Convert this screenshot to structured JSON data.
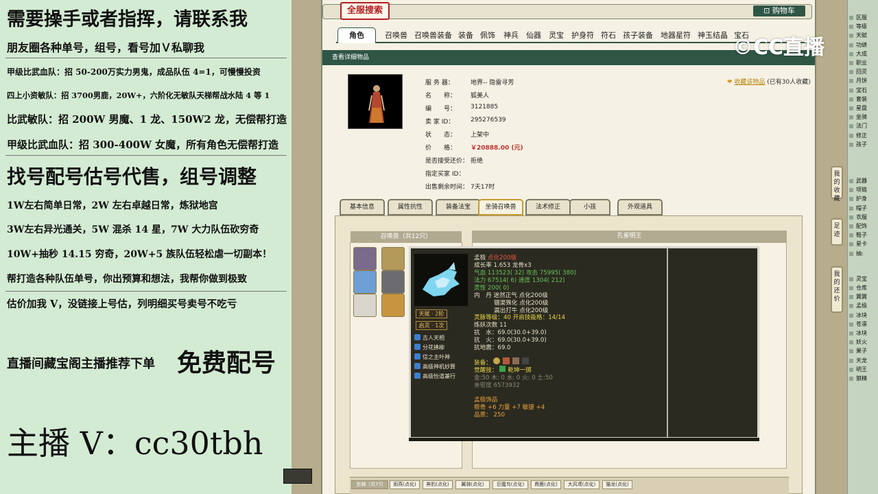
{
  "overlay": {
    "lines": [
      "需要操手或者指挥，请联系我",
      "朋友圈各种单号，组号，看号加Ｖ私聊我",
      "甲级比武血队：招 50-200万实力男鬼，成品队伍 4=1，可慢慢投资",
      "四上小资敏队：招 3700男鹿，20W+，六阶化无敏队天梯帮战水陆 4 等 1",
      "比武敏队：招 200W 男魔、1 龙、150W2 龙，无偿帮打造",
      "甲级比武血队：招 300-400W 女魔，所有角色无偿帮打造",
      "找号配号估号代售，组号调整",
      "1W左右简单日常，2W 左右卓越日常，炼狱地宫",
      "3W左右异光通关，5W 混杀 14 星，7W 大力队伍砍穷奇",
      "10W+抽秒 14.15 穷奇，20W+5 族队伍轻松虐一切副本！",
      "帮打造各种队伍单号，你出预算和想法，我帮你做到极致",
      "估价加我 V，没链接上号估，列明细买号卖号不吃亏",
      "直播间藏宝阁主播推荐下单",
      "免费配号",
      "主播 V：cc30tbh"
    ]
  },
  "site": {
    "logo": "全服搜索",
    "cart": "购物车",
    "nav_tabs": [
      "角色",
      "召唤兽",
      "召唤兽装备",
      "装备",
      "佩饰",
      "神兵",
      "仙器",
      "灵宝",
      "护身符",
      "符石",
      "孩子装备",
      "地器星符",
      "神玉结晶",
      "宝石"
    ],
    "section_title": "查看详细物品",
    "favorite": {
      "label": "收藏该物品",
      "count": "(已有30人收藏)"
    },
    "item_info": [
      {
        "label": "服 务 器：",
        "value": "地界-- 隐雷寻芳"
      },
      {
        "label": "名　　称：",
        "value": "狐美人"
      },
      {
        "label": "编　　号：",
        "value": "3121885"
      },
      {
        "label": "卖 家 ID：",
        "value": "295276539"
      },
      {
        "label": "状　　态：",
        "value": "上架中"
      },
      {
        "label": "价　　格：",
        "value": "￥20888.00 (元)"
      },
      {
        "label": "是否接受还价：",
        "value": "拒绝"
      },
      {
        "label": "指定买家 ID：",
        "value": ""
      },
      {
        "label": "出售剩余时间：",
        "value": "7天17时"
      }
    ],
    "detail_tabs": [
      "基本信息",
      "属性抗性",
      "装备法宝",
      "坐骑召唤兽",
      "法术修正",
      "小孩",
      "外观道具"
    ],
    "summon_header": "召唤兽（共12只）",
    "pet_name_header": "孔雀明王",
    "badges": [
      "天赋 · 2阶",
      "启灵 · 1次"
    ],
    "skills": [
      "吉人天相",
      "分花拂柳",
      "信之主叶神",
      "高级神机妙算",
      "高级怡道兼行"
    ],
    "tooltip": {
      "title": "孟极",
      "title_tag": "点化200级",
      "growth": "成长率 1.653 龙骨x3",
      "qixue": "气血  113523( 32) 攻击  75995( 380)",
      "fali": "法力  67514( 6) 速度  1304( 212)",
      "lingxing": "灵性  200( 0)",
      "neidan": "内　丹  迷然正气 点化200级",
      "neidan2": "锢渠殊化 点化200级",
      "neidan3": "漏出打牛 点化200级",
      "spirit": "灵脉等级：40  开启技能格：14/14",
      "lianyao": "炼妖次数  11",
      "kang1": "抗　水：69.0(30.0+39.0)",
      "kang2": "抗　火：69.0(30.0+39.0)",
      "kang3": "抗地震：69.0",
      "equip_label": "装备：",
      "awaken_label": "觉醒技：",
      "awaken": "乾坤一掷",
      "elements": "金:50 木: 0 水: 0 火: 0 土:50",
      "affinity": "亲密度 6573932",
      "ornament": "孟极饰品",
      "orn_stats": "根骨 +6 力量 +7 敏捷 +4",
      "quality": "品质：  250"
    },
    "bottom_tabs": [
      "坐骑（共7只",
      "雨燕(点化)",
      "奔豹(点化)",
      "翼骑(点化)",
      "巨魔鸟(点化)",
      "鼎鹿(点化)",
      "大风鸢(点化)",
      "猫龙(点化)"
    ],
    "side_buttons": [
      "我的收藏",
      "足迹",
      "我的还价"
    ]
  },
  "brand": {
    "cc_live": "CC直播"
  },
  "far_right": [
    "区服",
    "等级",
    "天赋",
    "功绩",
    "大成",
    "职业",
    "回灵",
    "月饼",
    "宝石",
    "套装",
    "星盘",
    "坐骑",
    "法门",
    "修正",
    "孩子",
    "武器",
    "项链",
    "护身",
    "帽子",
    "衣服",
    "配饰",
    "鞋子",
    "星卡",
    "抽:",
    "灵宝",
    "仓库",
    "翼翼",
    "孟极",
    "冰块",
    "苍凛",
    "冰块",
    "妖火",
    "果子",
    "天龙",
    "明王",
    "狼精"
  ]
}
